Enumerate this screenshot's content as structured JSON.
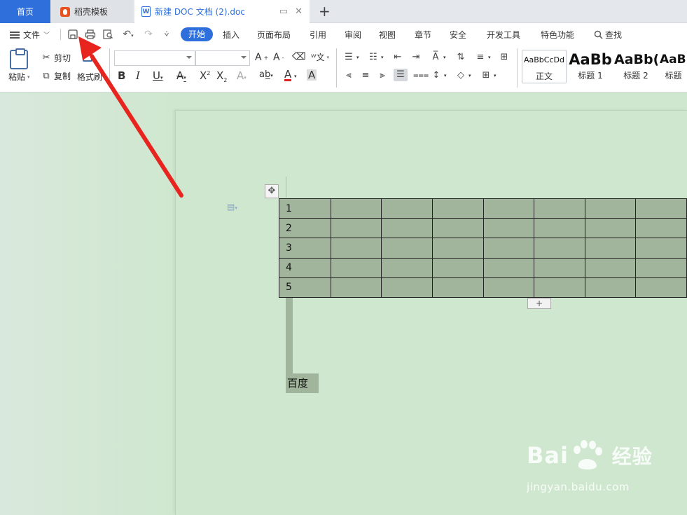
{
  "tabs": {
    "home": "首页",
    "daoke": "稻壳模板",
    "doc": "新建 DOC 文档 (2).doc",
    "doc_icon": "W"
  },
  "menu": {
    "file": "文件",
    "items": [
      "开始",
      "插入",
      "页面布局",
      "引用",
      "审阅",
      "视图",
      "章节",
      "安全",
      "开发工具",
      "特色功能",
      "查找"
    ]
  },
  "ribbon": {
    "paste": "粘贴",
    "cut": "剪切",
    "copy": "复制",
    "format_painter": "格式刷",
    "styles": [
      {
        "sample": "AaBbCcDd",
        "name": "正文"
      },
      {
        "sample": "AaBb",
        "name": "标题 1"
      },
      {
        "sample": "AaBb(",
        "name": "标题 2"
      },
      {
        "sample": "AaBl",
        "name": "标题"
      }
    ]
  },
  "table": {
    "rows": [
      [
        "1",
        "",
        "",
        "",
        "",
        "",
        "",
        ""
      ],
      [
        "2",
        "",
        "",
        "",
        "",
        "",
        "",
        ""
      ],
      [
        "3",
        "",
        "",
        "",
        "",
        "",
        "",
        ""
      ],
      [
        "4",
        "",
        "",
        "",
        "",
        "",
        "",
        ""
      ],
      [
        "5",
        "",
        "",
        "",
        "",
        "",
        "",
        ""
      ]
    ]
  },
  "body_text": "百度",
  "watermark": {
    "main": "Bai",
    "main2": "经验",
    "sub": "jingyan.baidu.com"
  },
  "colors": {
    "accent": "#2f6fdb",
    "doc_background": "#cfe7cf",
    "table_fill": "#a1b49c",
    "arrow": "#e8241e"
  }
}
